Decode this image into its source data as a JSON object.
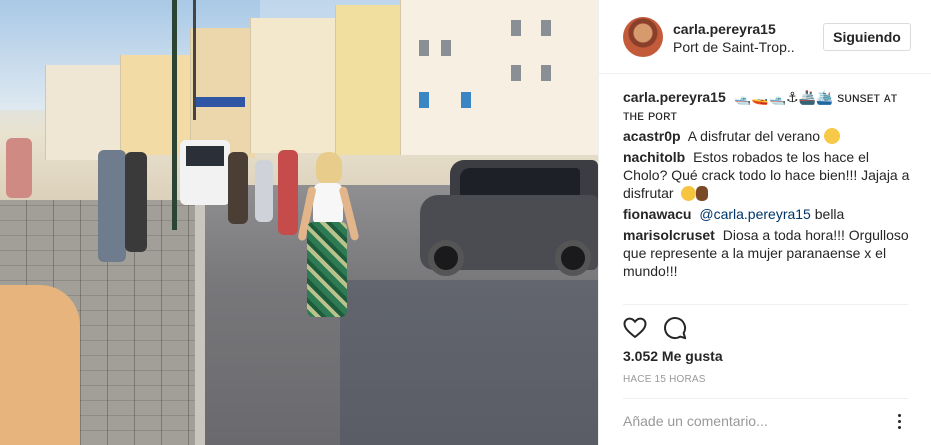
{
  "post_image": {
    "icon": "photo"
  },
  "header": {
    "username": "carla.pereyra15",
    "location": "Port de Saint-Trop..",
    "follow_label": "Siguiendo"
  },
  "comments": [
    {
      "user": "carla.pereyra15",
      "text": "🛥️🚤🛥️⚓🚢🛳️ sᴜɴsᴇᴛ ᴀᴛ ᴛʜᴇ ᴘᴏʀᴛ"
    },
    {
      "user": "acastr0p",
      "text": "A disfrutar del verano",
      "emoji": "hugging-face"
    },
    {
      "user": "nachitolb",
      "text": "Estos robados te los hace el Cholo? Qué crack todo lo hace bien!!! Jajaja a disfrutar",
      "emoji": "kiss-hand"
    },
    {
      "user": "fionawacu",
      "mention": "@carla.pereyra15",
      "text": "bella"
    },
    {
      "user": "marisolcruset",
      "text": "Diosa a toda hora!!! Orgulloso que represente a la mujer paranaense x el mundo!!!"
    }
  ],
  "actions": {
    "like_icon": "heart-outline-icon",
    "comment_icon": "speech-bubble-icon"
  },
  "likes": "3.052 Me gusta",
  "timestamp": "HACE 15 HORAS",
  "comment_input": {
    "placeholder": "Añade un comentario...",
    "value": ""
  },
  "colors": {
    "text": "#262626",
    "muted": "#999999",
    "mention": "#003569",
    "border": "#dbdbdb"
  }
}
